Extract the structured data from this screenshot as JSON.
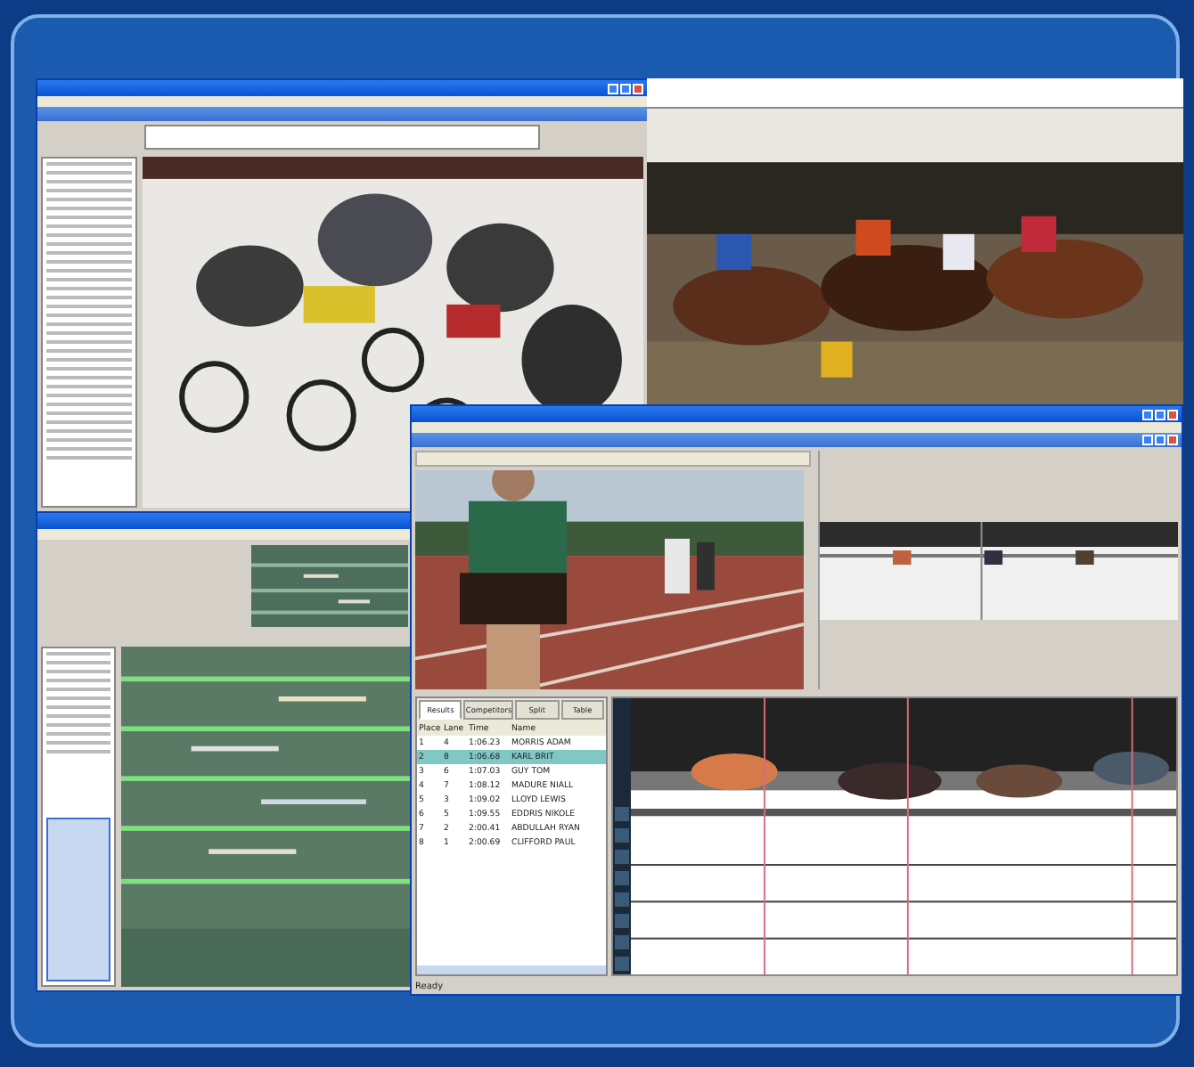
{
  "results_panel": {
    "tabs": [
      {
        "label": "Results",
        "selected": true
      },
      {
        "label": "Competitors",
        "selected": false
      },
      {
        "label": "Split",
        "selected": false
      },
      {
        "label": "Table",
        "selected": false
      }
    ],
    "columns": [
      "Place",
      "Lane",
      "Time",
      "Name"
    ],
    "rows": [
      {
        "place": "1",
        "lane": "4",
        "time": "1:06.23",
        "name": "MORRIS ADAM",
        "selected": false
      },
      {
        "place": "2",
        "lane": "8",
        "time": "1:06.68",
        "name": "KARL BRIT",
        "selected": true
      },
      {
        "place": "3",
        "lane": "6",
        "time": "1:07.03",
        "name": "GUY TOM",
        "selected": false
      },
      {
        "place": "4",
        "lane": "7",
        "time": "1:08.12",
        "name": "MADURE NIALL",
        "selected": false
      },
      {
        "place": "5",
        "lane": "3",
        "time": "1:09.02",
        "name": "LLOYD LEWIS",
        "selected": false
      },
      {
        "place": "6",
        "lane": "5",
        "time": "1:09.55",
        "name": "EDDRIS NIKOLE",
        "selected": false
      },
      {
        "place": "7",
        "lane": "2",
        "time": "2:00.41",
        "name": "ABDULLAH RYAN",
        "selected": false
      },
      {
        "place": "8",
        "lane": "1",
        "time": "2:00.69",
        "name": "CLIFFORD PAUL",
        "selected": false
      }
    ]
  },
  "status": "Ready"
}
